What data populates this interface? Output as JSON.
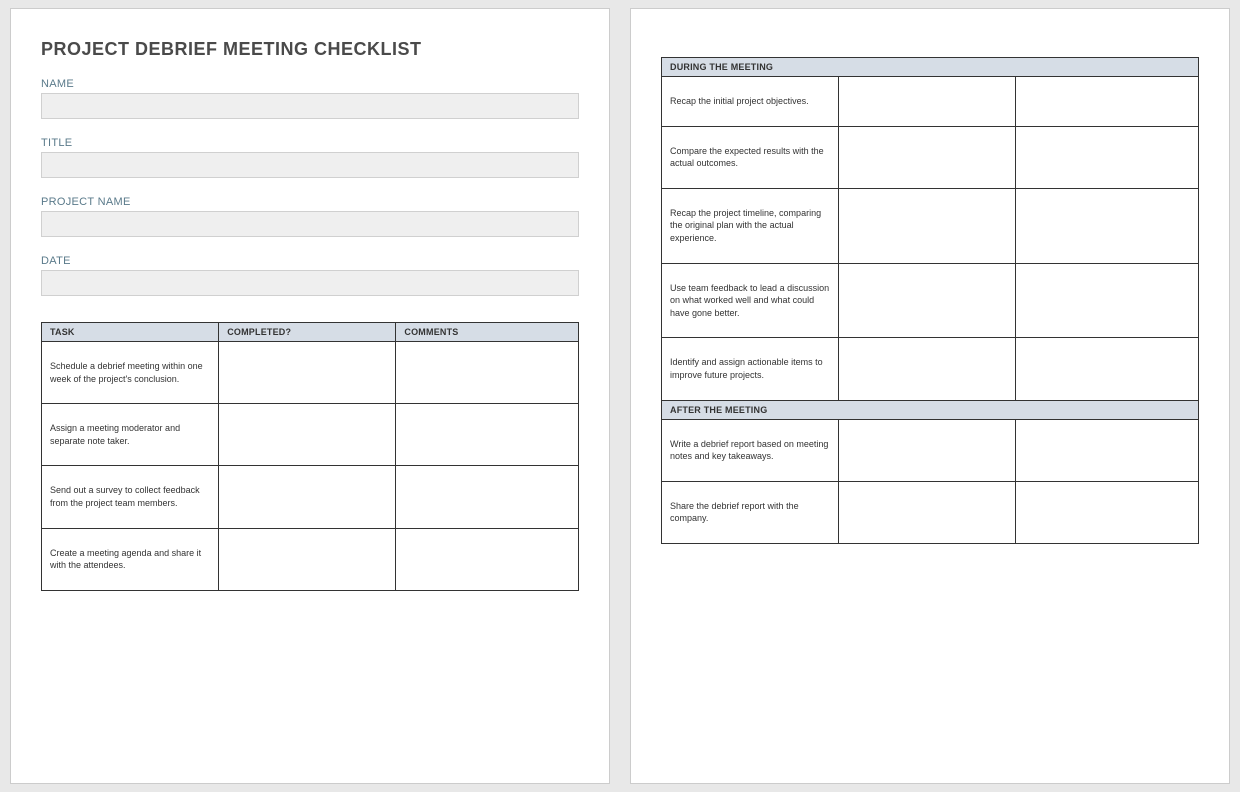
{
  "title": "PROJECT DEBRIEF MEETING CHECKLIST",
  "fields": {
    "name": {
      "label": "NAME",
      "value": ""
    },
    "title": {
      "label": "TITLE",
      "value": ""
    },
    "project": {
      "label": "PROJECT NAME",
      "value": ""
    },
    "date": {
      "label": "DATE",
      "value": ""
    }
  },
  "columns": {
    "task": "TASK",
    "completed": "COMPLETED?",
    "comments": "COMMENTS"
  },
  "before_tasks": [
    {
      "task": "Schedule a debrief meeting within one week of the project's conclusion.",
      "completed": "",
      "comments": ""
    },
    {
      "task": "Assign a meeting moderator and separate note taker.",
      "completed": "",
      "comments": ""
    },
    {
      "task": "Send out a survey to collect feedback from the project team members.",
      "completed": "",
      "comments": ""
    },
    {
      "task": "Create a meeting agenda and share it with the attendees.",
      "completed": "",
      "comments": ""
    }
  ],
  "sections": {
    "during": "DURING THE MEETING",
    "after": "AFTER THE MEETING"
  },
  "during_tasks": [
    {
      "task": "Recap the initial project objectives.",
      "completed": "",
      "comments": ""
    },
    {
      "task": "Compare the expected results with the actual outcomes.",
      "completed": "",
      "comments": ""
    },
    {
      "task": "Recap the project timeline, comparing the original plan with the actual experience.",
      "completed": "",
      "comments": ""
    },
    {
      "task": "Use team feedback to lead a discussion on what worked well and what could have gone better.",
      "completed": "",
      "comments": ""
    },
    {
      "task": "Identify and assign actionable items to improve future projects.",
      "completed": "",
      "comments": ""
    }
  ],
  "after_tasks": [
    {
      "task": "Write a debrief report based on meeting notes and key takeaways.",
      "completed": "",
      "comments": ""
    },
    {
      "task": "Share the debrief report with the company.",
      "completed": "",
      "comments": ""
    }
  ]
}
